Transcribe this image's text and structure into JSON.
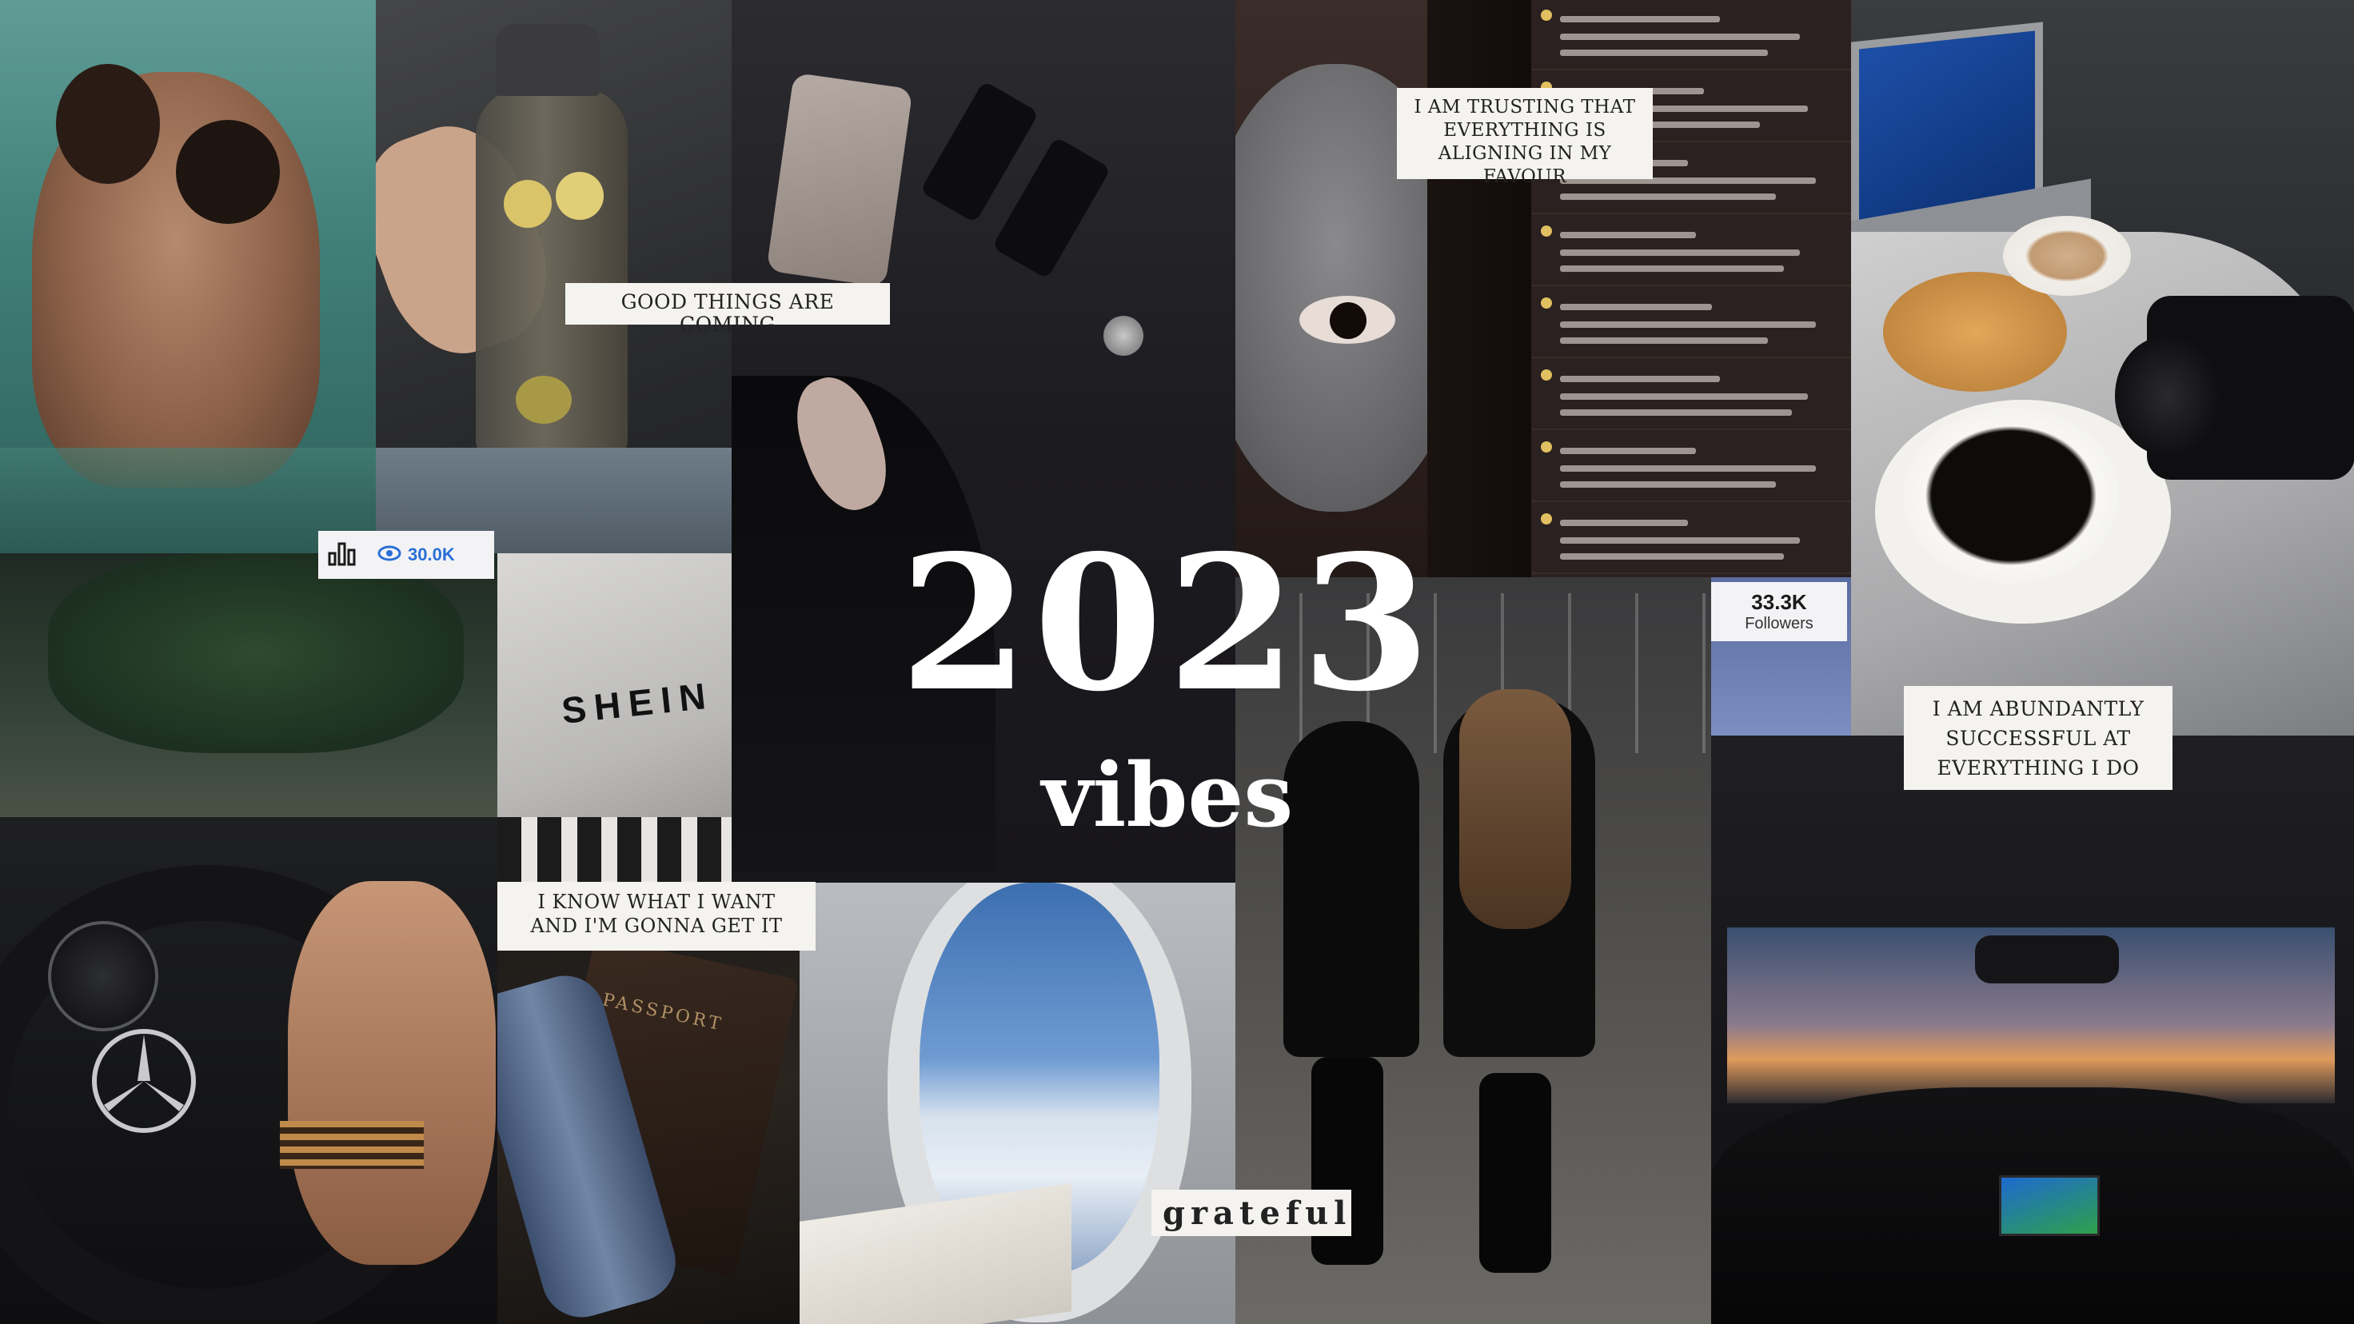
{
  "title": {
    "year": "2023",
    "subtitle": "vibes"
  },
  "captions": {
    "good_things": "GOOD THINGS ARE COMING",
    "trusting": "I AM TRUSTING THAT\nEVERYTHING IS\nALIGNING IN MY FAVOUR",
    "know_what": "I KNOW WHAT I WANT\nAND I'M GONNA GET IT",
    "abundantly": "I AM ABUNDANTLY\nSUCCESSFUL AT\nEVERYTHING I DO",
    "grateful": "grateful"
  },
  "stats": {
    "views": "30.0K",
    "followers_count": "33.3K",
    "followers_label": "Followers"
  },
  "labels": {
    "bag_brand": "SHEIN",
    "passport": "PASSPORT"
  },
  "icons": {
    "bar_chart": "bar-chart-icon",
    "eye": "eye-icon",
    "mercedes": "mercedes-logo-icon"
  },
  "colors": {
    "caption_bg": "#f4f3f0",
    "title_text": "#ffffff",
    "stat_accent": "#2a6fd6"
  }
}
